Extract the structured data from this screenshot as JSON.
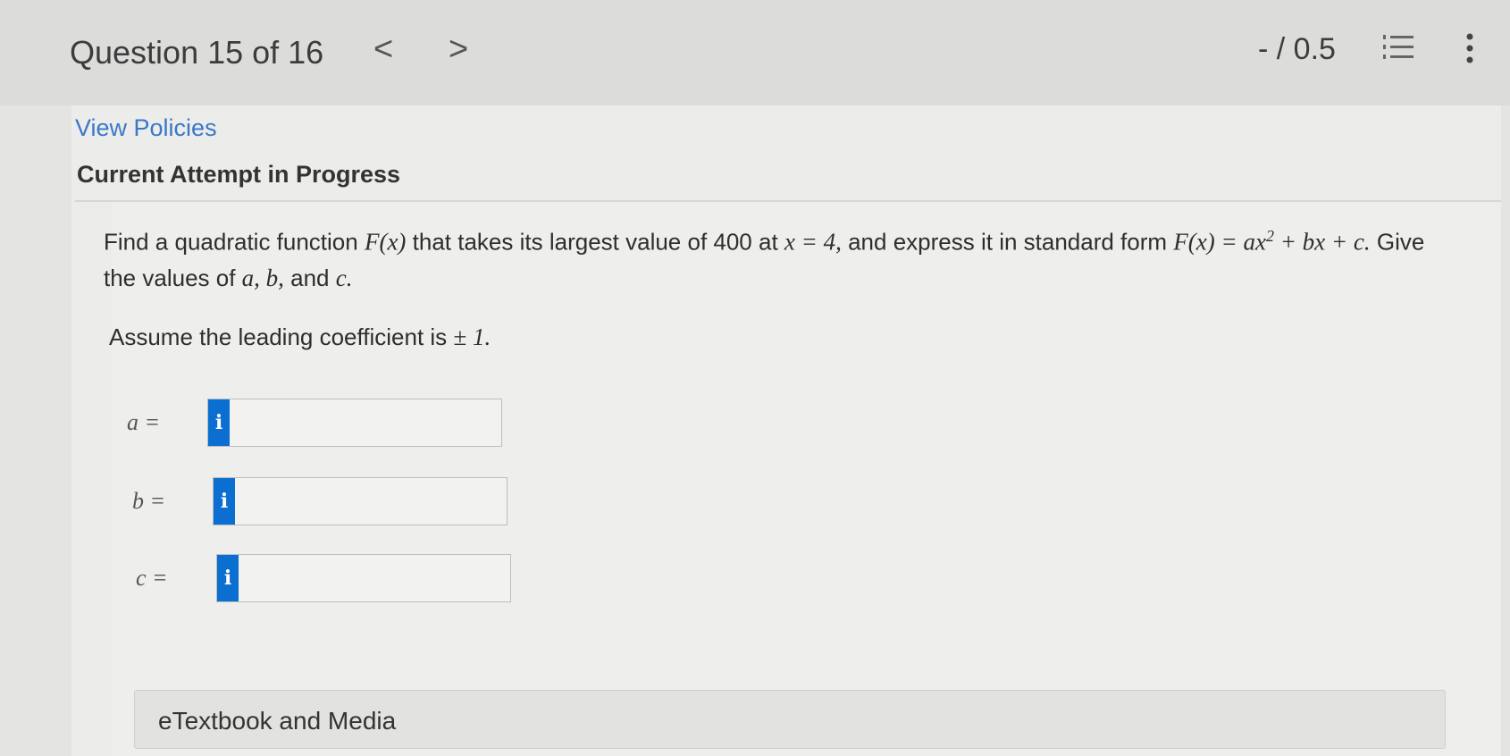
{
  "header": {
    "question_label": "Question 15 of 16",
    "prev_glyph": "<",
    "next_glyph": ">",
    "score": "- / 0.5"
  },
  "links": {
    "view_policies": "View Policies"
  },
  "attempt_status": "Current Attempt in Progress",
  "question": {
    "p1": "Find a quadratic function ",
    "F_of_x": "F(x)",
    "p2": " that takes its largest value of 400 at ",
    "x_eq": "x = 4,",
    "p3": " and express it in standard form ",
    "standard_form_lhs": "F(x) = ax",
    "exp": "2",
    "standard_form_rhs": " + bx + c.",
    "p4": " Give the values of ",
    "vars": "a, b,",
    "p5": " and ",
    "var_c": "c.",
    "assume_text": "Assume the leading coefficient is ",
    "assume_math": "± 1."
  },
  "answers": [
    {
      "label": "a =",
      "value": "",
      "info": "i"
    },
    {
      "label": "b =",
      "value": "",
      "info": "i"
    },
    {
      "label": "c =",
      "value": "",
      "info": "i"
    }
  ],
  "etextbook": "eTextbook and Media",
  "colors": {
    "link": "#3a78c8",
    "info_button": "#0b6fd1"
  }
}
